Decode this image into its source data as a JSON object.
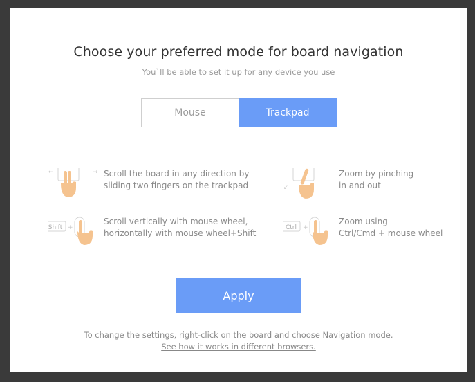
{
  "dialog": {
    "title": "Choose your preferred mode for board navigation",
    "subtitle": "You`ll be able to set it up for any device you use",
    "toggle": {
      "option_mouse": "Mouse",
      "option_trackpad": "Trackpad",
      "selected": "Trackpad"
    },
    "features": [
      {
        "icon": "trackpad-two-finger-scroll-icon",
        "text": "Scroll the board in any direction by\nsliding two fingers on the trackpad"
      },
      {
        "icon": "trackpad-pinch-zoom-icon",
        "text": "Zoom by pinching\nin and out"
      },
      {
        "icon": "shift-mouse-wheel-icon",
        "key_label": "Shift",
        "text": "Scroll vertically with mouse wheel,\nhorizontally with mouse wheel+Shift"
      },
      {
        "icon": "ctrl-mouse-wheel-icon",
        "key_label": "Ctrl",
        "text": "Zoom using\nCtrl/Cmd + mouse wheel"
      }
    ],
    "apply_label": "Apply",
    "footer_text": "To change the settings, right-click on the board and choose Navigation mode.",
    "footer_link": "See how it works in different browsers."
  },
  "colors": {
    "accent": "#6a9cf7",
    "hand": "#f5c38f"
  }
}
